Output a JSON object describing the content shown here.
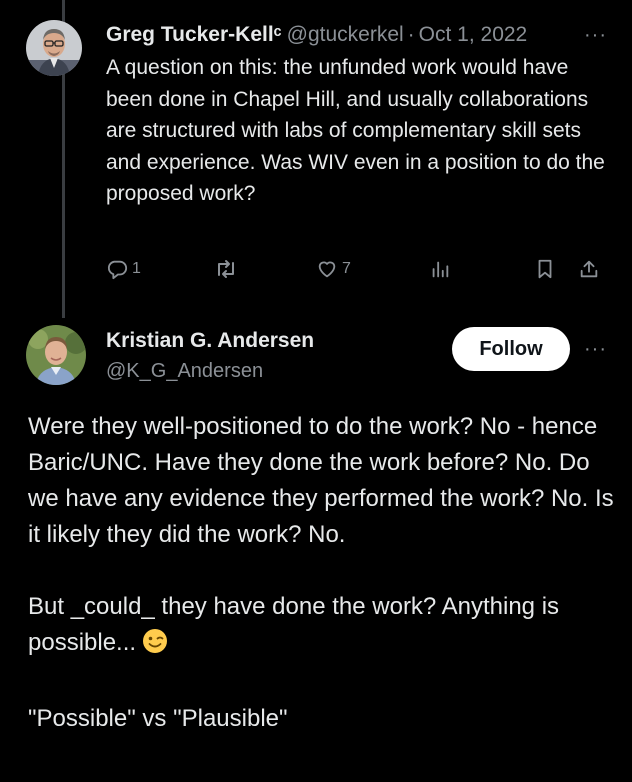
{
  "reply_tweet": {
    "name": "Greg Tucker-Kellᶜ",
    "handle": "@gtuckerkel",
    "separator": "·",
    "date": "Oct 1, 2022",
    "more": "···",
    "text": "A question on this: the unfunded work would have been done in Chapel Hill, and usually collaborations are structured with labs of complementary skill sets and experience. Was WIV even in a position to do the proposed work?",
    "actions": {
      "reply_icon": "reply-icon",
      "reply_count": "1",
      "retweet_icon": "retweet-icon",
      "like_icon": "heart-icon",
      "like_count": "7",
      "views_icon": "views-icon",
      "bookmark_icon": "bookmark-icon",
      "share_icon": "share-icon"
    }
  },
  "main_tweet": {
    "name": "Kristian G. Andersen",
    "handle": "@K_G_Andersen",
    "follow_label": "Follow",
    "more": "···",
    "paragraphs": [
      "Were they well-positioned to do the work? No - hence Baric/UNC. Have they done the work before? No. Do we have any evidence they performed the work? No. Is it likely they did the work? No.",
      "But _could_ they have done the work? Anything is possible...",
      "\"Possible\" vs \"Plausible\""
    ],
    "emoji": "winking-face-emoji"
  },
  "colors": {
    "background": "#000000",
    "text": "#e7e9ea",
    "secondary": "#8b9096",
    "follow_bg": "#ffffff"
  }
}
